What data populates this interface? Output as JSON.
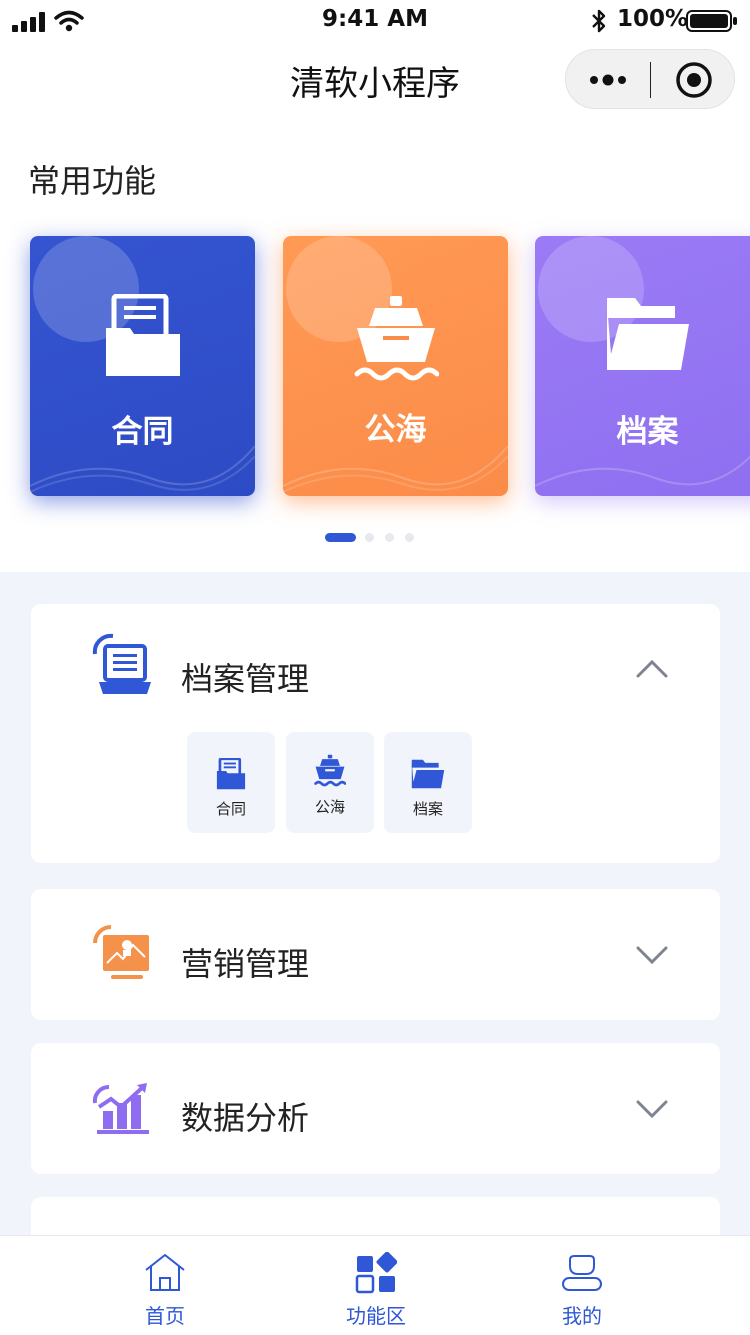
{
  "status_bar": {
    "time": "9:41 AM",
    "battery": "100%"
  },
  "nav": {
    "title": "清软小程序"
  },
  "common": {
    "title": "常用功能",
    "cards": [
      {
        "label": "合同",
        "icon": "contract-folder-icon",
        "color": "#3554d1"
      },
      {
        "label": "公海",
        "icon": "ship-icon",
        "color": "#fb8b48"
      },
      {
        "label": "档案",
        "icon": "folder-icon",
        "color": "#9276f2"
      }
    ],
    "carousel": {
      "pages": 4,
      "active_page": 1
    }
  },
  "panels": [
    {
      "title": "档案管理",
      "icon": "archive-laptop-icon",
      "expanded": true,
      "items": [
        {
          "label": "合同",
          "icon": "contract-folder-icon"
        },
        {
          "label": "公海",
          "icon": "ship-icon"
        },
        {
          "label": "档案",
          "icon": "folder-icon"
        }
      ]
    },
    {
      "title": "营销管理",
      "icon": "marketing-monitor-icon",
      "expanded": false
    },
    {
      "title": "数据分析",
      "icon": "data-chart-icon",
      "expanded": false
    }
  ],
  "tab_bar": {
    "items": [
      {
        "label": "首页",
        "icon": "home-icon"
      },
      {
        "label": "功能区",
        "icon": "apps-grid-icon",
        "active": true
      },
      {
        "label": "我的",
        "icon": "user-icon"
      }
    ]
  },
  "colors": {
    "accent": "#2f57d6",
    "orange": "#fb8b48",
    "purple": "#9276f2"
  }
}
